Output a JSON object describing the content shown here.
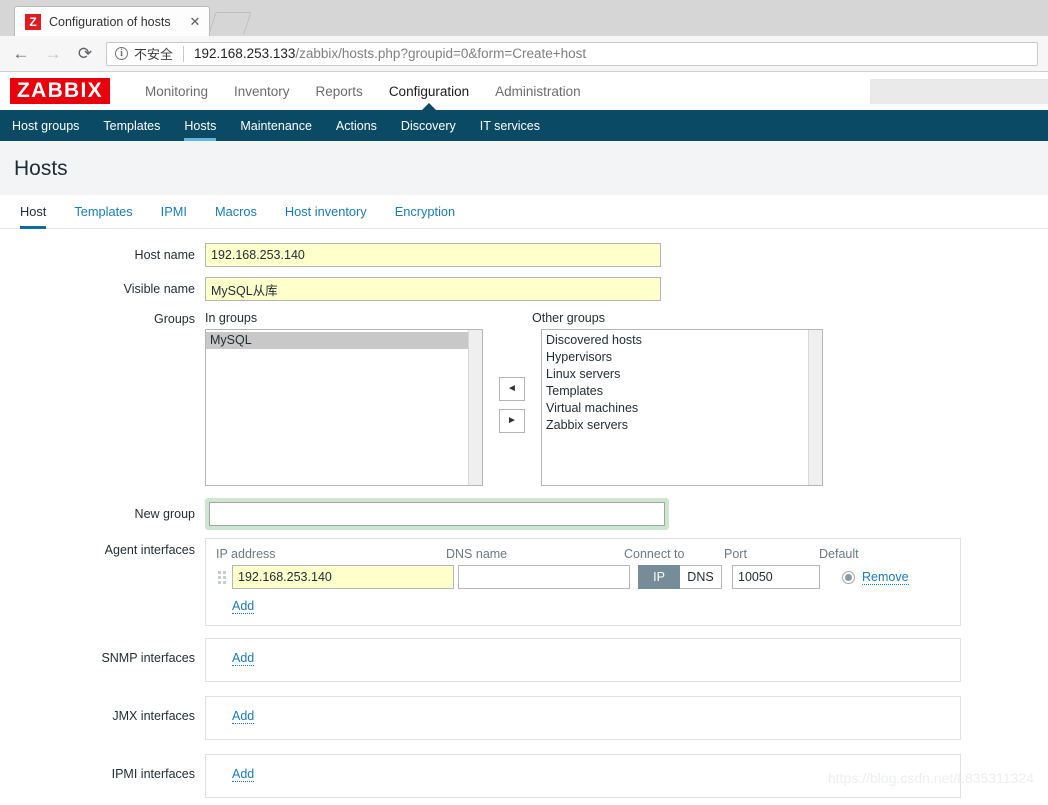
{
  "browser": {
    "tab": {
      "title": "Configuration of hosts",
      "favicon_letter": "Z",
      "close_label": "✕"
    },
    "nav": {
      "back": "←",
      "forward": "→",
      "reload": "⟳"
    },
    "omnibox": {
      "info_icon": "i",
      "security_label": "不安全",
      "url_host": "192.168.253.133",
      "url_path": "/zabbix/hosts.php?groupid=0&form=Create+host"
    }
  },
  "app": {
    "logo": "ZABBIX",
    "top_menu": [
      {
        "label": "Monitoring",
        "selected": false
      },
      {
        "label": "Inventory",
        "selected": false
      },
      {
        "label": "Reports",
        "selected": false
      },
      {
        "label": "Configuration",
        "selected": true
      },
      {
        "label": "Administration",
        "selected": false
      }
    ],
    "search_placeholder": "",
    "sub_nav": [
      {
        "label": "Host groups",
        "selected": false
      },
      {
        "label": "Templates",
        "selected": false
      },
      {
        "label": "Hosts",
        "selected": true
      },
      {
        "label": "Maintenance",
        "selected": false
      },
      {
        "label": "Actions",
        "selected": false
      },
      {
        "label": "Discovery",
        "selected": false
      },
      {
        "label": "IT services",
        "selected": false
      }
    ]
  },
  "page": {
    "title": "Hosts",
    "form_tabs": [
      {
        "label": "Host",
        "selected": true
      },
      {
        "label": "Templates",
        "selected": false
      },
      {
        "label": "IPMI",
        "selected": false
      },
      {
        "label": "Macros",
        "selected": false
      },
      {
        "label": "Host inventory",
        "selected": false
      },
      {
        "label": "Encryption",
        "selected": false
      }
    ]
  },
  "form": {
    "host_name": {
      "label": "Host name",
      "value": "192.168.253.140",
      "placeholder": ""
    },
    "visible_name": {
      "label": "Visible name",
      "value": "MySQL从库",
      "placeholder": ""
    },
    "groups": {
      "label": "Groups",
      "in_groups_label": "In groups",
      "other_groups_label": "Other groups",
      "in_groups": [
        {
          "label": "MySQL",
          "selected": true
        }
      ],
      "other_groups": [
        {
          "label": "Discovered hosts",
          "selected": false
        },
        {
          "label": "Hypervisors",
          "selected": false
        },
        {
          "label": "Linux servers",
          "selected": false
        },
        {
          "label": "Templates",
          "selected": false
        },
        {
          "label": "Virtual machines",
          "selected": false
        },
        {
          "label": "Zabbix servers",
          "selected": false
        }
      ],
      "move_left_icon": "◄",
      "move_right_icon": "►"
    },
    "new_group": {
      "label": "New group",
      "value": "",
      "placeholder": ""
    },
    "agent_interfaces": {
      "label": "Agent interfaces",
      "columns": {
        "ip": "IP address",
        "dns": "DNS name",
        "connect_to": "Connect to",
        "port": "Port",
        "default": "Default"
      },
      "rows": [
        {
          "ip": "192.168.253.140",
          "dns": "",
          "connect_to_selected": "IP",
          "connect_options": [
            "IP",
            "DNS"
          ],
          "port": "10050",
          "is_default": true,
          "remove_label": "Remove"
        }
      ],
      "add_label": "Add"
    },
    "snmp_interfaces": {
      "label": "SNMP interfaces",
      "add_label": "Add"
    },
    "jmx_interfaces": {
      "label": "JMX interfaces",
      "add_label": "Add"
    },
    "ipmi_interfaces": {
      "label": "IPMI interfaces",
      "add_label": "Add"
    }
  },
  "watermark": "https://blog.csdn.net/L835311324",
  "colors": {
    "brand_red": "#e8000c",
    "nav_dark_blue": "#0a4a64",
    "link_blue": "#1a7bb9",
    "field_yellow": "#ffffcc",
    "focus_green": "#cfe5cd",
    "toggle_active": "#768d99"
  }
}
